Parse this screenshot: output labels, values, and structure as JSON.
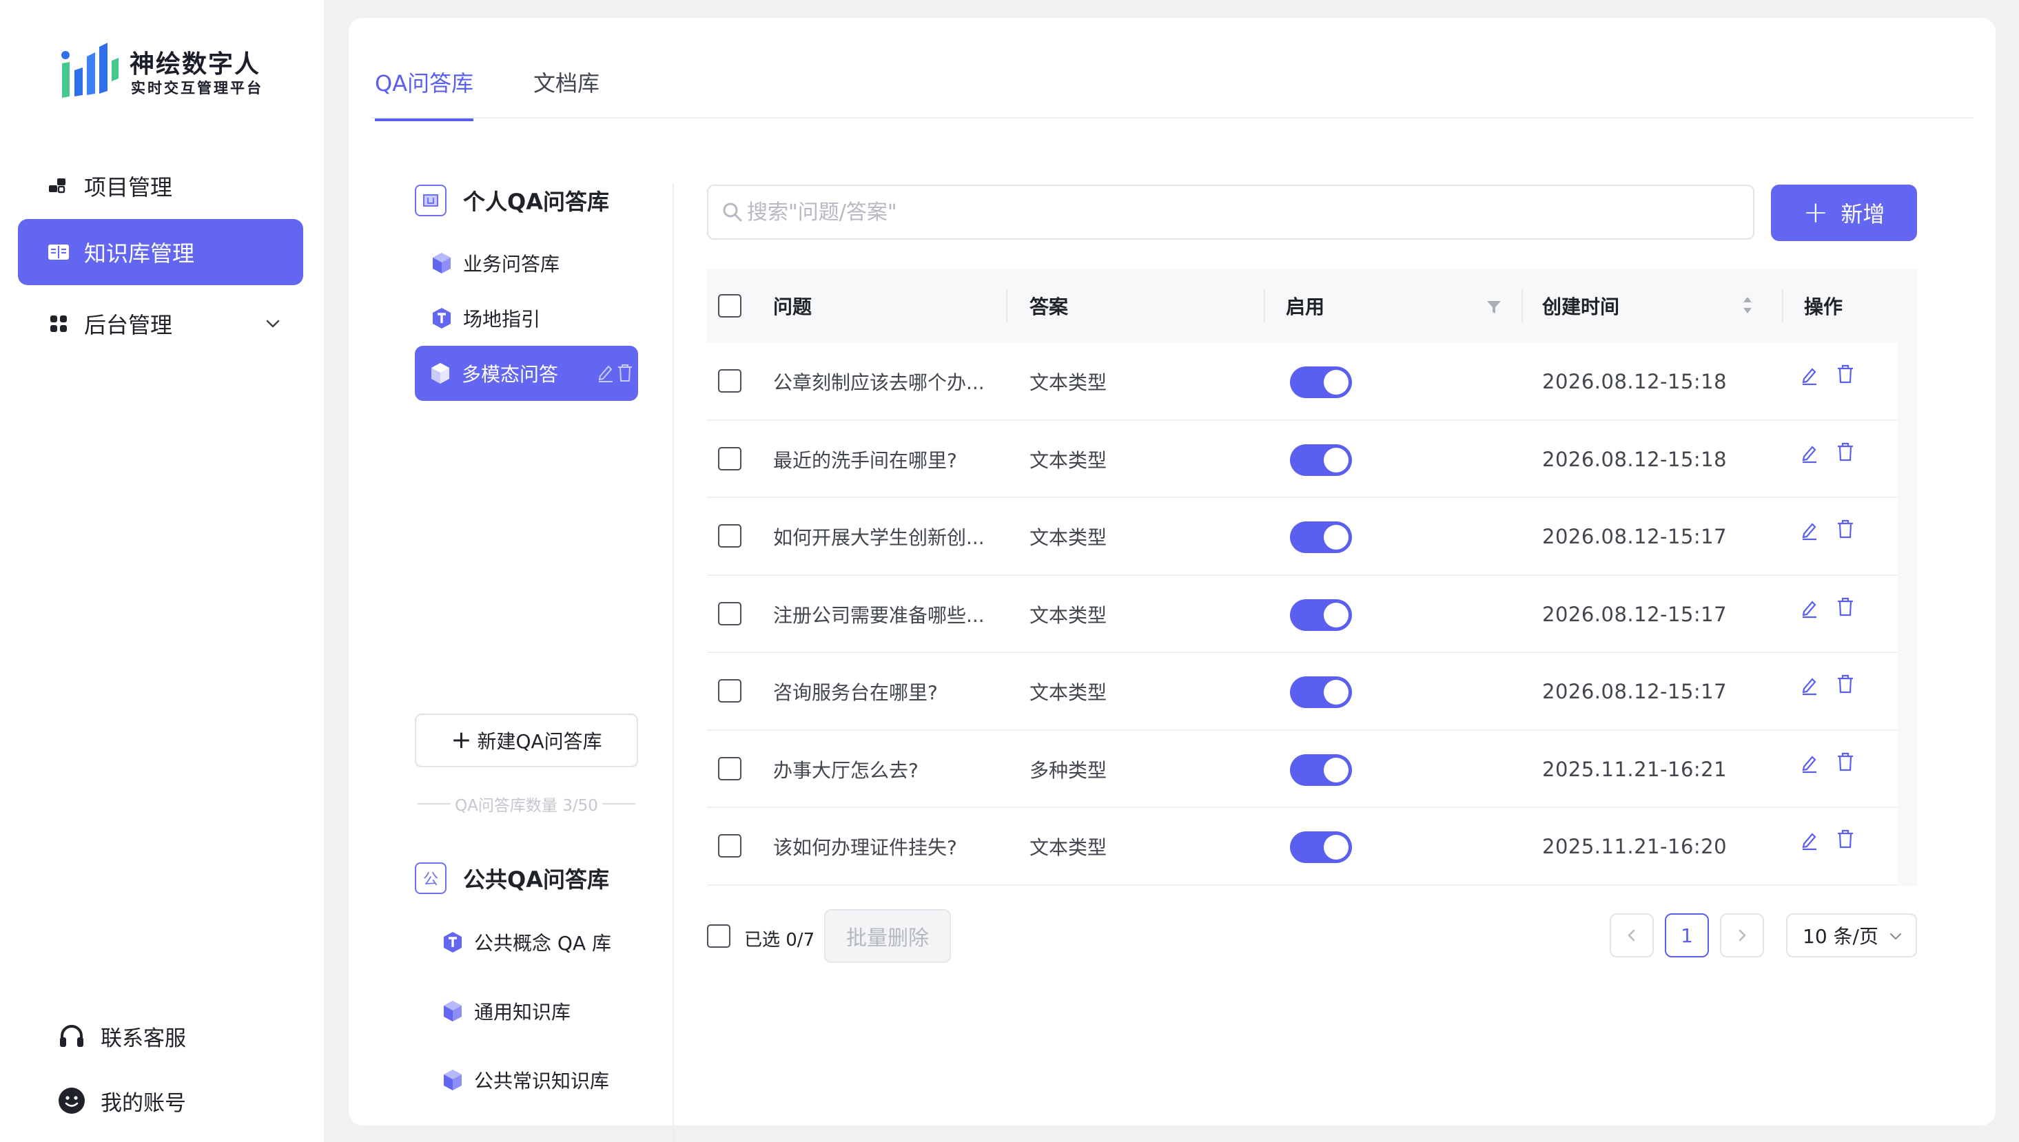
{
  "brand": {
    "title": "神绘数字人",
    "subtitle": "实时交互管理平台",
    "colors": {
      "accent": "#6366f0",
      "logo_blue": "#2f6fe8",
      "logo_green": "#45c88f"
    }
  },
  "sidebar": {
    "items": [
      {
        "label": "项目管理",
        "icon": "project-blocks-icon",
        "active": false
      },
      {
        "label": "知识库管理",
        "icon": "book-icon",
        "active": true
      },
      {
        "label": "后台管理",
        "icon": "grid-icon",
        "active": false,
        "expandable": true
      }
    ],
    "footer": [
      {
        "label": "联系客服",
        "icon": "headset-icon"
      },
      {
        "label": "我的账号",
        "icon": "smiley-avatar-icon"
      }
    ]
  },
  "tabs": [
    {
      "label": "QA问答库",
      "active": true
    },
    {
      "label": "文档库",
      "active": false
    }
  ],
  "libraries": {
    "personal_title": "个人QA问答库",
    "personal": [
      {
        "label": "业务问答库",
        "icon": "cube-icon"
      },
      {
        "label": "场地指引",
        "icon": "t-hexagon-icon"
      },
      {
        "label": "多模态问答",
        "icon": "cube-icon",
        "active": true
      }
    ],
    "new_button": "新建QA问答库",
    "count_label": "QA问答库数量  3/50",
    "public_badge": "公",
    "public_title": "公共QA问答库",
    "public": [
      {
        "label": "公共概念 QA 库",
        "icon": "t-hexagon-icon"
      },
      {
        "label": "通用知识库",
        "icon": "cube-icon"
      },
      {
        "label": "公共常识知识库",
        "icon": "cube-icon"
      }
    ]
  },
  "search": {
    "placeholder": "搜索\"问题/答案\"",
    "value": ""
  },
  "add_button": "新增",
  "table": {
    "columns": {
      "question": "问题",
      "answer": "答案",
      "enabled": "启用",
      "created": "创建时间",
      "actions": "操作"
    },
    "rows": [
      {
        "question": "公章刻制应该去哪个办...",
        "answer": "文本类型",
        "enabled": true,
        "created": "2026.08.12-15:18"
      },
      {
        "question": "最近的洗手间在哪里?",
        "answer": "文本类型",
        "enabled": true,
        "created": "2026.08.12-15:18"
      },
      {
        "question": "如何开展大学生创新创...",
        "answer": "文本类型",
        "enabled": true,
        "created": "2026.08.12-15:17"
      },
      {
        "question": "注册公司需要准备哪些...",
        "answer": "文本类型",
        "enabled": true,
        "created": "2026.08.12-15:17"
      },
      {
        "question": "咨询服务台在哪里?",
        "answer": "文本类型",
        "enabled": true,
        "created": "2026.08.12-15:17"
      },
      {
        "question": "办事大厅怎么去?",
        "answer": "多种类型",
        "enabled": true,
        "created": "2025.11.21-16:21"
      },
      {
        "question": "该如何办理证件挂失?",
        "answer": "文本类型",
        "enabled": true,
        "created": "2025.11.21-16:20"
      }
    ]
  },
  "footer": {
    "selected": "已选 0/7",
    "batch_delete": "批量删除",
    "current_page": "1",
    "page_size": "10 条/页"
  }
}
